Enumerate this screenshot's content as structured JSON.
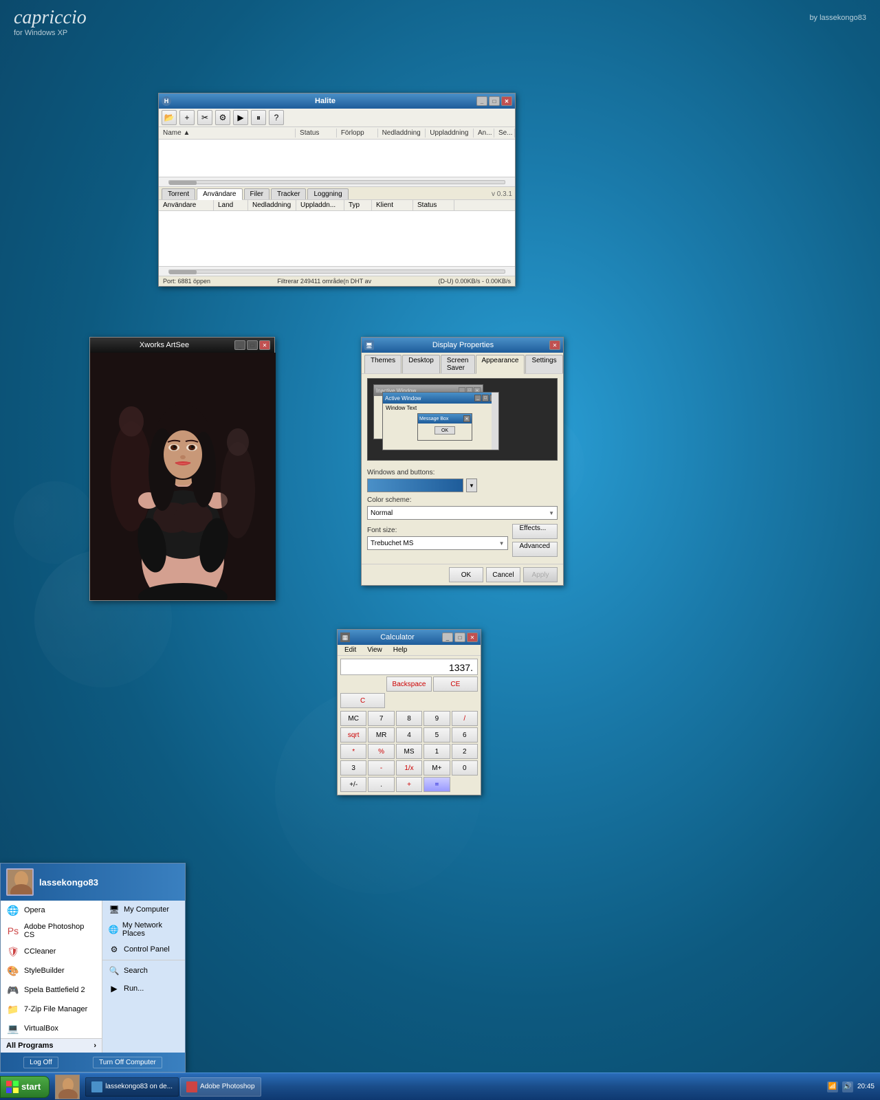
{
  "watermark": {
    "title": "capriccio",
    "subtitle": "for Windows XP",
    "author": "by lassekongo83"
  },
  "halite": {
    "title": "Halite",
    "toolbar_icons": [
      "folder",
      "add",
      "settings",
      "gear",
      "play",
      "pause",
      "help"
    ],
    "columns": [
      "Name",
      "Status",
      "Förlopp",
      "Nedladdning",
      "Uppladdning",
      "An...",
      "Se..."
    ],
    "scroll_pos": "0",
    "tabs": [
      "Torrent",
      "Användare",
      "Filer",
      "Tracker",
      "Loggning"
    ],
    "active_tab": "Användare",
    "version": "v 0.3.1",
    "peer_columns": [
      "Användare",
      "Land",
      "Nedladdning",
      "Uppladdn...",
      "Typ",
      "Klient",
      "Status"
    ],
    "statusbar_left": "Port: 6881 öppen",
    "statusbar_mid": "Filtrerar 249411 område(n DHT av",
    "statusbar_right": "(D-U) 0.00KB/s - 0.00KB/s"
  },
  "artsee": {
    "title": "Xworks ArtSee"
  },
  "display_props": {
    "title": "Display Properties",
    "tabs": [
      "Themes",
      "Desktop",
      "Screen Saver",
      "Appearance",
      "Settings"
    ],
    "active_tab": "Appearance",
    "preview": {
      "inactive_label": "Inactive Window",
      "active_label": "Active Window",
      "window_text": "Window Text",
      "msgbox_title": "Message Box",
      "msgbox_btn": "OK"
    },
    "windows_buttons_label": "Windows and buttons:",
    "color_scheme_label": "Color scheme:",
    "color_scheme_value": "Normal",
    "font_size_label": "Font size:",
    "font_size_value": "Trebuchet MS",
    "effects_btn": "Effects...",
    "advanced_btn": "Advanced",
    "ok_btn": "OK",
    "cancel_btn": "Cancel",
    "apply_btn": "Apply"
  },
  "calculator": {
    "title": "Calculator",
    "menu": [
      "Edit",
      "View",
      "Help"
    ],
    "display": "1337.",
    "buttons_row1": [
      "Backspace",
      "CE",
      "C"
    ],
    "buttons_row2": [
      "MC",
      "7",
      "8",
      "9",
      "/",
      "sqrt"
    ],
    "buttons_row3": [
      "MR",
      "4",
      "5",
      "6",
      "*",
      "%"
    ],
    "buttons_row4": [
      "MS",
      "1",
      "2",
      "3",
      "-",
      "1/x"
    ],
    "buttons_row5": [
      "M+",
      "0",
      "+/-",
      ".",
      "+",
      " = "
    ]
  },
  "start_menu": {
    "username": "lassekongo83",
    "left_items": [
      {
        "label": "Opera",
        "icon": "🌐"
      },
      {
        "label": "Adobe Photoshop CS",
        "icon": "🎨"
      },
      {
        "label": "CCleaner",
        "icon": "🧹"
      },
      {
        "label": "StyleBuilder",
        "icon": "🎨"
      },
      {
        "label": "Spela Battlefield 2",
        "icon": "🎮"
      },
      {
        "label": "7-Zip File Manager",
        "icon": "📁"
      },
      {
        "label": "VirtualBox",
        "icon": "💻"
      }
    ],
    "all_programs": "All Programs",
    "right_items": [
      {
        "label": "My Computer",
        "icon": "🖥"
      },
      {
        "label": "My Network Places",
        "icon": "🌐"
      },
      {
        "label": "Control Panel",
        "icon": "⚙"
      },
      {
        "label": "Search",
        "icon": "🔍"
      },
      {
        "label": "Run...",
        "icon": "▶"
      }
    ],
    "footer_btns": [
      "Log Off",
      "Turn Off Computer"
    ]
  },
  "taskbar": {
    "start_label": "start",
    "items": [
      {
        "label": "lassekongo83 on de...",
        "active": true
      },
      {
        "label": "Adobe Photoshop",
        "active": false
      }
    ],
    "clock": "20:45"
  }
}
